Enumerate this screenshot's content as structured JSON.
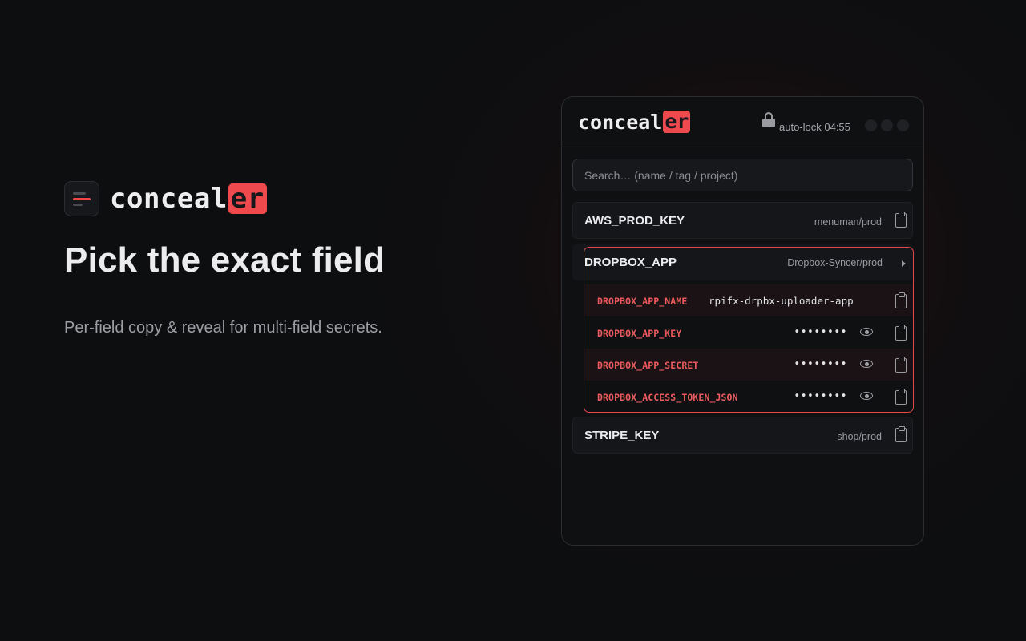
{
  "hero": {
    "wordmark_main": "conceal",
    "wordmark_hl": "er",
    "headline": "Pick the exact field",
    "subline": "Per-field copy & reveal for multi-field secrets."
  },
  "popup": {
    "logo_main": "conceal",
    "logo_hl": "er",
    "autolock": "auto-lock 04:55",
    "search_placeholder": "Search… (name / tag / project)",
    "secrets": [
      {
        "name": "AWS_PROD_KEY",
        "meta": "menuman/prod"
      },
      {
        "name": "DROPBOX_APP",
        "meta": "Dropbox-Syncer/prod"
      },
      {
        "name": "STRIPE_KEY",
        "meta": "shop/prod"
      }
    ],
    "fields": [
      {
        "name": "DROPBOX_APP_NAME",
        "value": "rpifx-drpbx-uploader-app"
      },
      {
        "name": "DROPBOX_APP_KEY",
        "value": "••••••••"
      },
      {
        "name": "DROPBOX_APP_SECRET",
        "value": "••••••••"
      },
      {
        "name": "DROPBOX_ACCESS_TOKEN_JSON",
        "value": "••••••••"
      }
    ]
  },
  "colors": {
    "accent": "#ee4a4e",
    "background": "#0d0e10",
    "panel": "#0f1012"
  },
  "icons": [
    "menu-logo-icon",
    "lock-icon",
    "clipboard-icon",
    "eye-icon",
    "chevron-right-icon"
  ]
}
